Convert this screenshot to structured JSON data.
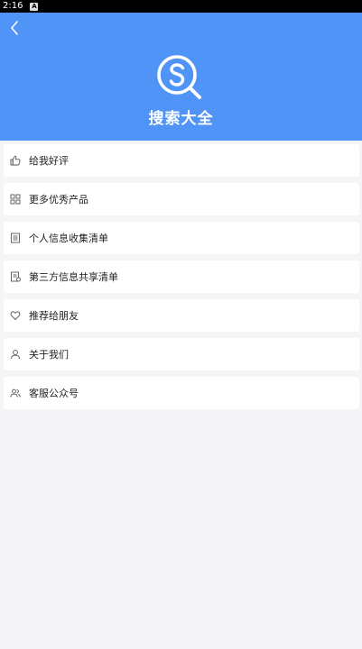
{
  "status_bar": {
    "time": "2:16",
    "indicator": "A"
  },
  "header": {
    "back_icon": "chevron-left-icon",
    "logo_icon": "search-s-logo-icon",
    "title": "搜索大全",
    "accent_color": "#4f94f6"
  },
  "menu": {
    "items": [
      {
        "label": "给我好评",
        "icon": "thumbs-up-icon"
      },
      {
        "label": "更多优秀产品",
        "icon": "grid-icon"
      },
      {
        "label": "个人信息收集清单",
        "icon": "list-document-icon"
      },
      {
        "label": "第三方信息共享清单",
        "icon": "share-document-icon"
      },
      {
        "label": "推荐给朋友",
        "icon": "heart-icon"
      },
      {
        "label": "关于我们",
        "icon": "user-icon"
      },
      {
        "label": "客服公众号",
        "icon": "users-icon"
      }
    ]
  }
}
